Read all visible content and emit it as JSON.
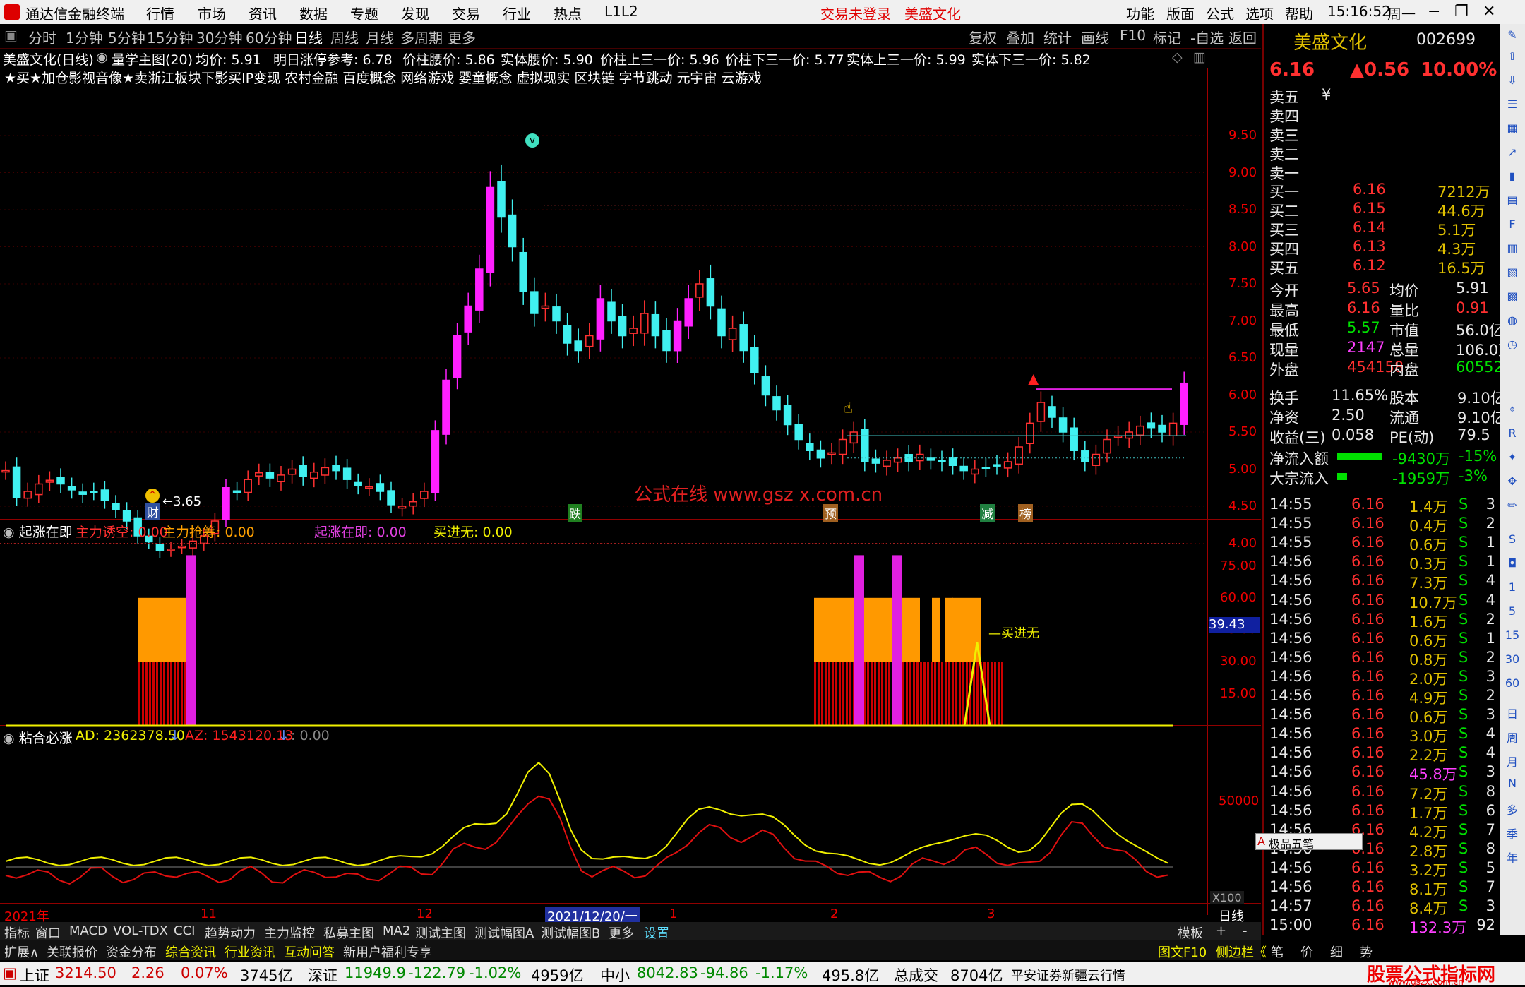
{
  "menubar": {
    "app_title": "通达信金融终端",
    "items": [
      "行情",
      "市场",
      "资讯",
      "数据",
      "专题",
      "发现",
      "交易",
      "行业",
      "热点",
      "L1L2"
    ],
    "center_red": [
      "交易未登录",
      "美盛文化"
    ],
    "right": [
      "功能",
      "版面",
      "公式",
      "选项",
      "帮助"
    ],
    "time": "15:16:52",
    "weekday": "周一"
  },
  "toolbar": {
    "periods": [
      "分时",
      "1分钟",
      "5分钟",
      "15分钟",
      "30分钟",
      "60分钟",
      "日线",
      "周线",
      "月线",
      "多周期",
      "更多"
    ],
    "active": "日线",
    "right": [
      "复权",
      "叠加",
      "统计",
      "画线",
      "F10",
      "标记",
      "-自选",
      "返回"
    ]
  },
  "infobar": {
    "stock": "美盛文化(日线)",
    "formula": "量学主图(20)",
    "avg": "均价: 5.91",
    "limit": "明日涨停参考: 6.78",
    "waist": "价柱腰价: 5.86",
    "body_waist": "实体腰价: 5.90",
    "upper_third": "价柱上三一价: 5.96",
    "lower_third": "价柱下三一价: 5.77",
    "body_upper": "实体上三一价: 5.99",
    "body_lower": "实体下三一价: 5.82"
  },
  "concepts": "★买★加仓影视音像★卖浙江板块下影买IP变现 农村金融 百度概念 网络游戏 婴童概念 虚拟现实 区块链 字节跳动 元宇宙 云游戏",
  "main_chart": {
    "y_ticks": [
      "9.50",
      "9.00",
      "8.50",
      "8.00",
      "7.50",
      "7.00",
      "6.50",
      "6.00",
      "5.50",
      "5.00",
      "4.50",
      "4.00"
    ],
    "low_label": "3.65",
    "markers": [
      "财",
      "跌",
      "预",
      "减",
      "榜"
    ],
    "watermark": "公式在线 www.gsz x.com.cn"
  },
  "ind1": {
    "name": "起涨在即",
    "a": "主力诱空: 0.00",
    "b": "主力抢筹: 0.00",
    "c": "起涨在即: 0.00",
    "d": "买进无: 0.00",
    "ticks": [
      "75.00",
      "60.00",
      "45.00",
      "30.00",
      "15.00"
    ],
    "current": "39.43",
    "label": "买进无"
  },
  "ind2": {
    "name": "粘合必涨",
    "ad": "AD: 2362378.50",
    "az": "AZ: 1543120.13",
    "zero": ": 0.00",
    "tick": "50000",
    "scale": "X100"
  },
  "time_axis": [
    "2021年",
    "11",
    "12",
    "2021/12/20/一",
    "1",
    "2",
    "3"
  ],
  "time_axis_right": "日线",
  "quote": {
    "name": "美盛文化",
    "code": "002699",
    "price": "6.16",
    "change": "▲0.56",
    "pct": "10.00%",
    "asks": [
      "卖五",
      "卖四",
      "卖三",
      "卖二",
      "卖一"
    ],
    "ask_flag": "¥",
    "bids": [
      {
        "label": "买一",
        "price": "6.16",
        "vol": "7212万"
      },
      {
        "label": "买二",
        "price": "6.15",
        "vol": "44.6万"
      },
      {
        "label": "买三",
        "price": "6.14",
        "vol": "5.1万"
      },
      {
        "label": "买四",
        "price": "6.13",
        "vol": "4.3万"
      },
      {
        "label": "买五",
        "price": "6.12",
        "vol": "16.5万"
      }
    ],
    "stats": [
      {
        "l": "今开",
        "v": "5.65",
        "r": "均价",
        "rv": "5.91"
      },
      {
        "l": "最高",
        "v": "6.16",
        "r": "量比",
        "rv": "0.91"
      },
      {
        "l": "最低",
        "v": "5.57",
        "r": "市值",
        "rv": "56.0亿"
      },
      {
        "l": "现量",
        "v": "2147",
        "r": "总量",
        "rv": "106.0万"
      },
      {
        "l": "外盘",
        "v": "454158",
        "r": "内盘",
        "rv": "605528"
      }
    ],
    "fund": [
      {
        "l": "换手",
        "v": "11.65%",
        "r": "股本",
        "rv": "9.10亿"
      },
      {
        "l": "净资",
        "v": "2.50",
        "r": "流通",
        "rv": "9.10亿"
      },
      {
        "l": "收益(三)",
        "v": "0.058",
        "r": "PE(动)",
        "rv": "79.5"
      }
    ],
    "flows": [
      {
        "l": "净流入额",
        "v": "-9430万",
        "p": "-15%"
      },
      {
        "l": "大宗流入",
        "v": "-1959万",
        "p": "-3%"
      }
    ],
    "ticks": [
      [
        "14:55",
        "6.16",
        "1.4万",
        "S",
        "3"
      ],
      [
        "14:55",
        "6.16",
        "0.4万",
        "S",
        "2"
      ],
      [
        "14:55",
        "6.16",
        "0.6万",
        "S",
        "1"
      ],
      [
        "14:56",
        "6.16",
        "0.3万",
        "S",
        "1"
      ],
      [
        "14:56",
        "6.16",
        "7.3万",
        "S",
        "4"
      ],
      [
        "14:56",
        "6.16",
        "10.7万",
        "S",
        "4"
      ],
      [
        "14:56",
        "6.16",
        "1.6万",
        "S",
        "2"
      ],
      [
        "14:56",
        "6.16",
        "0.6万",
        "S",
        "1"
      ],
      [
        "14:56",
        "6.16",
        "0.8万",
        "S",
        "2"
      ],
      [
        "14:56",
        "6.16",
        "2.0万",
        "S",
        "3"
      ],
      [
        "14:56",
        "6.16",
        "4.9万",
        "S",
        "2"
      ],
      [
        "14:56",
        "6.16",
        "0.6万",
        "S",
        "3"
      ],
      [
        "14:56",
        "6.16",
        "3.0万",
        "S",
        "4"
      ],
      [
        "14:56",
        "6.16",
        "2.2万",
        "S",
        "4"
      ],
      [
        "14:56",
        "6.16",
        "45.8万",
        "S",
        "3"
      ],
      [
        "14:56",
        "6.16",
        "7.2万",
        "S",
        "8"
      ],
      [
        "14:56",
        "6.16",
        "1.7万",
        "S",
        "6"
      ],
      [
        "14:56",
        "6.16",
        "4.2万",
        "S",
        "7"
      ],
      [
        "14:56",
        "6.16",
        "2.8万",
        "S",
        "8"
      ],
      [
        "14:56",
        "6.16",
        "3.2万",
        "S",
        "5"
      ],
      [
        "14:56",
        "6.16",
        "8.1万",
        "S",
        "7"
      ],
      [
        "14:57",
        "6.16",
        "8.4万",
        "S",
        "3"
      ],
      [
        "15:00",
        "6.16",
        "132.3万",
        "",
        "92"
      ]
    ],
    "ime": "极品五笔"
  },
  "bottom_tabs": [
    "指标",
    "窗口",
    "MACD",
    "VOL-TDX",
    "CCI",
    "趋势动力",
    "主力监控",
    "私募主图",
    "MA2",
    "测试主图",
    "测试幅图A",
    "测试幅图B",
    "更多",
    "设置"
  ],
  "bottom_right": [
    "模板",
    "+",
    "-"
  ],
  "bottom_tabs2": [
    "扩展∧",
    "关联报价",
    "资金分布",
    "综合资讯",
    "行业资讯",
    "互动问答",
    "新用户福利专享"
  ],
  "bottom_right2": [
    "图文F10",
    "侧边栏《",
    "笔",
    "价",
    "细",
    "势"
  ],
  "status": {
    "sh_label": "上证",
    "sh": "3214.50",
    "sh_chg": "2.26",
    "sh_pct": "0.07%",
    "sh_amt": "3745亿",
    "sz_label": "深证",
    "sz": "11949.9",
    "sz_chg": "-122.79",
    "sz_pct": "-1.02%",
    "sz_amt": "4959亿",
    "zx_label": "中小",
    "zx": "8042.83",
    "zx_chg": "-94.86",
    "zx_pct": "-1.17%",
    "zx_amt": "495.8亿",
    "total_label": "总成交",
    "total": "8704亿",
    "broker": "平安证券新疆云行情",
    "brand": "股票公式指标网",
    "brand_url": "www.gszx.com.cn"
  }
}
